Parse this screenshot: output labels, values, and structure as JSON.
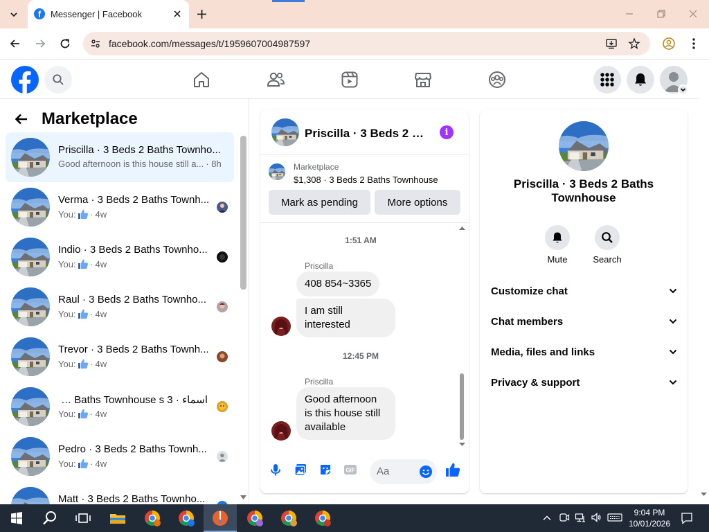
{
  "browser": {
    "tab_title": "Messenger | Facebook",
    "url": "facebook.com/messages/t/1959607004987597"
  },
  "fb": {
    "logo_letter": "f"
  },
  "left": {
    "title": "Marketplace",
    "conversations": [
      {
        "name": "Priscilla · 3 Beds 2 Baths Townho...",
        "preview": "Good afternoon is this house still a...",
        "time": "· 8h",
        "you": false,
        "active": true
      },
      {
        "name": "Verma · 3 Beds 2 Baths Townh...",
        "preview": "You:",
        "time": "· 4w",
        "you": true,
        "active": false
      },
      {
        "name": "Indio · 3 Beds 2 Baths Townho...",
        "preview": "You:",
        "time": "· 4w",
        "you": true,
        "active": false
      },
      {
        "name": "Raul · 3 Beds 2 Baths Townho...",
        "preview": "You:",
        "time": "· 4w",
        "you": true,
        "active": false
      },
      {
        "name": "Trevor · 3 Beds 2 Baths Townh...",
        "preview": "You:",
        "time": "· 4w",
        "you": true,
        "active": false
      },
      {
        "name": "اسماء · 3 Beds 2 Baths Townhouse s...",
        "preview": "You:",
        "time": "· 4w",
        "you": true,
        "active": false
      },
      {
        "name": "Pedro · 3 Beds 2 Baths Townh...",
        "preview": "You:",
        "time": "· 4w",
        "you": true,
        "active": false
      },
      {
        "name": "Matt · 3 Beds 2 Baths Townho...",
        "preview": "",
        "time": "",
        "you": false,
        "active": false
      }
    ]
  },
  "chat": {
    "title": "Priscilla · 3 Beds 2 Ba...",
    "info_glyph": "i",
    "listing_tag": "Marketplace",
    "listing_price": "$1,308 · 3 Beds 2 Baths Townhouse",
    "mark_pending": "Mark as pending",
    "more_options": "More options",
    "time1": "1:51 AM",
    "sender1": "Priscilla",
    "msg1": "408 854~3365",
    "msg2": "I am still interested",
    "time2": "12:45 PM",
    "sender2": "Priscilla",
    "msg3": "Good afternoon is this house still available",
    "composer_placeholder": "Aa"
  },
  "panel": {
    "name": "Priscilla · 3 Beds 2 Baths Townhouse",
    "mute": "Mute",
    "search": "Search",
    "sections": [
      "Customize chat",
      "Chat members",
      "Media, files and links",
      "Privacy & support"
    ]
  },
  "taskbar": {
    "time": "9:04 PM",
    "date": "10/01/2026"
  },
  "colors": {
    "fb_blue": "#0866ff",
    "messenger_purple": "#a033ff",
    "active_row": "#ebf5ff"
  }
}
